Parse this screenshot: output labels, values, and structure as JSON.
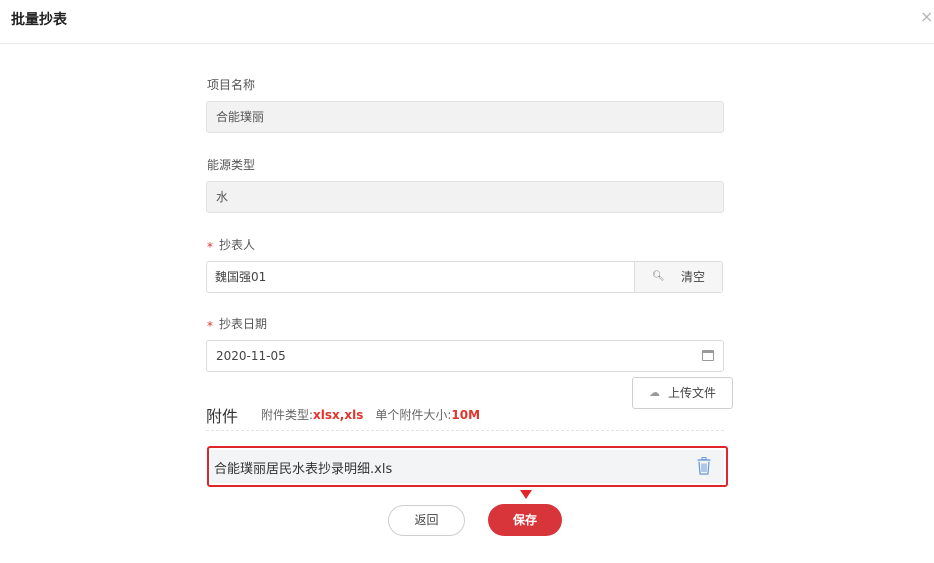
{
  "dialog": {
    "title": "批量抄表",
    "close_icon": "×"
  },
  "form": {
    "project": {
      "label": "项目名称",
      "value": "合能璞丽"
    },
    "energy": {
      "label": "能源类型",
      "value": "水"
    },
    "reader": {
      "required_mark": "*",
      "label": "抄表人",
      "value": "魏国强01",
      "clear_label": "清空",
      "search_icon": "search-icon"
    },
    "date": {
      "required_mark": "*",
      "label": "抄表日期",
      "value": "2020-11-05",
      "calendar_icon": "calendar-icon"
    }
  },
  "attachment": {
    "title": "附件",
    "type_label": "附件类型:",
    "type_value": "xlsx,xls",
    "size_label": "单个附件大小:",
    "size_value": "10M",
    "upload_label": "上传文件",
    "upload_icon": "cloud-upload-icon",
    "files": [
      {
        "name": "合能璞丽居民水表抄录明细.xls",
        "delete_icon": "trash-icon"
      }
    ]
  },
  "actions": {
    "back_label": "返回",
    "save_label": "保存"
  },
  "colors": {
    "accent": "#d8353a",
    "highlight": "#e0262b"
  }
}
